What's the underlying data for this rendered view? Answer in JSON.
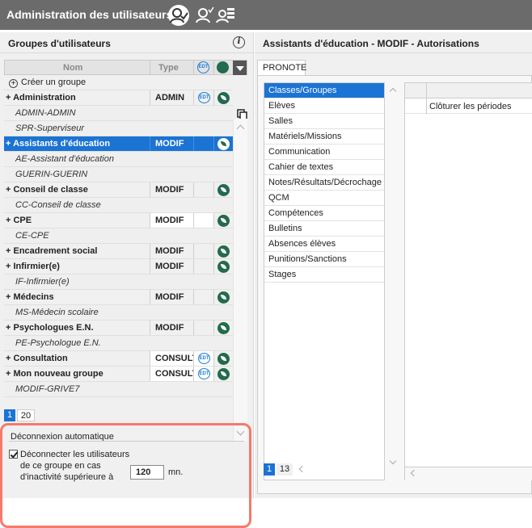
{
  "title": "Administration des utilisateurs",
  "left_panel": {
    "title": "Groupes d'utilisateurs",
    "columns": {
      "name": "Nom",
      "type": "Type",
      "edt": "EDT"
    },
    "create_label": "Créer un groupe",
    "rows": [
      {
        "kind": "group",
        "label": "Administration",
        "type": "ADMIN",
        "edt": true,
        "leaf": true
      },
      {
        "kind": "sub",
        "label": "ADMIN-ADMIN"
      },
      {
        "kind": "sub",
        "label": "SPR-Superviseur"
      },
      {
        "kind": "group",
        "label": "Assistants d'éducation",
        "type": "MODIF",
        "edt": false,
        "leaf": true,
        "selected": true
      },
      {
        "kind": "sub",
        "label": "AE-Assistant d'éducation"
      },
      {
        "kind": "sub",
        "label": "GUERIN-GUERIN"
      },
      {
        "kind": "group",
        "label": "Conseil de classe",
        "type": "MODIF",
        "edt": false,
        "leaf": true
      },
      {
        "kind": "sub",
        "label": "CC-Conseil de classe"
      },
      {
        "kind": "group",
        "label": "CPE",
        "type": "MODIF",
        "edt": false,
        "leaf": true,
        "light": true
      },
      {
        "kind": "sub",
        "label": "CE-CPE"
      },
      {
        "kind": "group",
        "label": "Encadrement social",
        "type": "MODIF",
        "edt": false,
        "leaf": true
      },
      {
        "kind": "group",
        "label": "Infirmier(e)",
        "type": "MODIF",
        "edt": false,
        "leaf": true
      },
      {
        "kind": "sub",
        "label": "IF-Infirmier(e)"
      },
      {
        "kind": "group",
        "label": "Médecins",
        "type": "MODIF",
        "edt": false,
        "leaf": true
      },
      {
        "kind": "sub",
        "label": "MS-Médecin scolaire"
      },
      {
        "kind": "group",
        "label": "Psychologues E.N.",
        "type": "MODIF",
        "edt": false,
        "leaf": true
      },
      {
        "kind": "sub",
        "label": "PE-Psychologue E.N."
      },
      {
        "kind": "group",
        "label": "Consultation",
        "type": "CONSULT",
        "edt": true,
        "leaf": true,
        "light": true
      },
      {
        "kind": "group",
        "label": "Mon nouveau groupe",
        "type": "CONSULT",
        "edt": true,
        "leaf": true,
        "light": true
      },
      {
        "kind": "sub",
        "label": "MODIF-GRIVE7"
      }
    ],
    "pager": {
      "current": "1",
      "total": "20"
    },
    "logout": {
      "title": "Déconnexion automatique",
      "checked": true,
      "line1": "Déconnecter les utilisateurs",
      "line2": "de ce groupe en cas",
      "line3": "d'inactivité supérieure à",
      "minutes": "120",
      "unit": "mn."
    }
  },
  "right_panel": {
    "title": "Assistants d'éducation - MODIF - Autorisations",
    "tab": "PRONOTE",
    "menu": [
      "Classes/Groupes",
      "Elèves",
      "Salles",
      "Matériels/Missions",
      "Communication",
      "Cahier de textes",
      "Notes/Résultats/Décrochage",
      "QCM",
      "Compétences",
      "Bulletins",
      "Absences élèves",
      "Punitions/Sanctions",
      "Stages"
    ],
    "menu_selected": 0,
    "menu_pager": {
      "current": "1",
      "total": "13"
    },
    "permission_row": "Clôturer les périodes"
  }
}
